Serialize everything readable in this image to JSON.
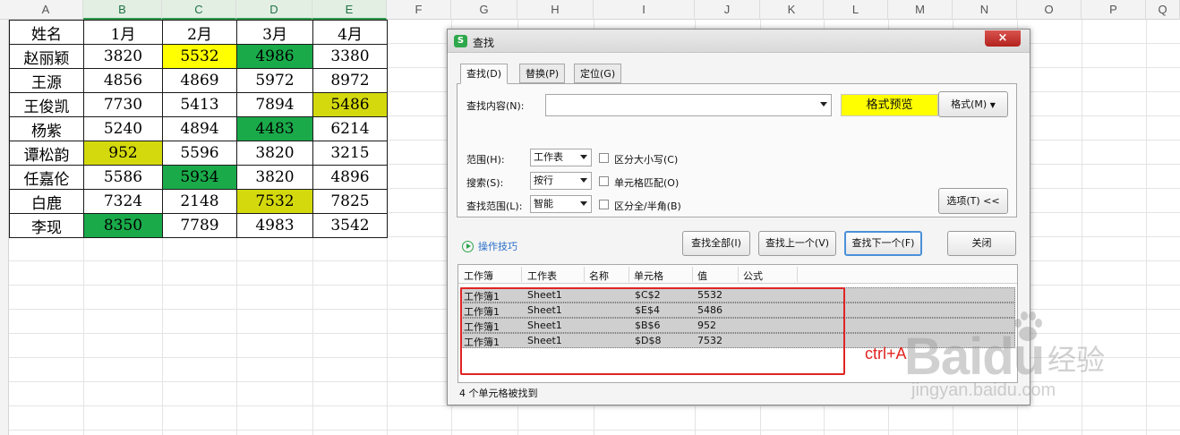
{
  "sheet": {
    "columns": [
      "A",
      "B",
      "C",
      "D",
      "E",
      "F",
      "G",
      "H",
      "I",
      "J",
      "K",
      "L",
      "M",
      "N",
      "O",
      "P",
      "Q"
    ],
    "header_row": [
      "姓名",
      "1月",
      "2月",
      "3月",
      "4月"
    ],
    "rows": [
      [
        "赵丽颖",
        "3820",
        "5532",
        "4986",
        "3380"
      ],
      [
        "王源",
        "4856",
        "4869",
        "5972",
        "8972"
      ],
      [
        "王俊凯",
        "7730",
        "5413",
        "7894",
        "5486"
      ],
      [
        "杨紫",
        "5240",
        "4894",
        "4483",
        "6214"
      ],
      [
        "谭松韵",
        "952",
        "5596",
        "3820",
        "3215"
      ],
      [
        "任嘉伦",
        "5586",
        "5934",
        "3820",
        "4896"
      ],
      [
        "白鹿",
        "7324",
        "2148",
        "7532",
        "7825"
      ],
      [
        "李现",
        "8350",
        "7789",
        "4983",
        "3542"
      ]
    ],
    "highlight_colors": {
      "yellow": "#ffff00",
      "green": "#1aaa4a",
      "olive": "#d4d90e"
    }
  },
  "dialog": {
    "title": "查找",
    "title_icon": "S",
    "close_label": "×",
    "tabs": [
      "查找(D)",
      "替换(P)",
      "定位(G)"
    ],
    "find_label": "查找内容(N):",
    "find_value": "",
    "preview_label": "格式预览",
    "format_button": "格式(M)",
    "scope_label": "范围(H):",
    "scope_value": "工作表",
    "search_label": "搜索(S):",
    "search_value": "按行",
    "lookin_label": "查找范围(L):",
    "lookin_value": "智能",
    "opt_case": "区分大小写(C)",
    "opt_cell": "单元格匹配(O)",
    "opt_width": "区分全/半角(B)",
    "options_button": "选项(T) <<",
    "tips_link": "操作技巧",
    "btn_find_all": "查找全部(I)",
    "btn_find_prev": "查找上一个(V)",
    "btn_find_next": "查找下一个(F)",
    "btn_close": "关闭",
    "results_headers": [
      "工作簿",
      "工作表",
      "名称",
      "单元格",
      "值",
      "公式"
    ],
    "results": [
      [
        "工作簿1",
        "Sheet1",
        "",
        "$C$2",
        "5532",
        ""
      ],
      [
        "工作簿1",
        "Sheet1",
        "",
        "$E$4",
        "5486",
        ""
      ],
      [
        "工作簿1",
        "Sheet1",
        "",
        "$B$6",
        "952",
        ""
      ],
      [
        "工作簿1",
        "Sheet1",
        "",
        "$D$8",
        "7532",
        ""
      ]
    ],
    "status": "4 个单元格被找到"
  },
  "annotation": "ctrl+A",
  "watermark": {
    "brand": "Bai",
    "brand2": "du",
    "cn": "经验",
    "url": "jingyan.baidu.com"
  }
}
